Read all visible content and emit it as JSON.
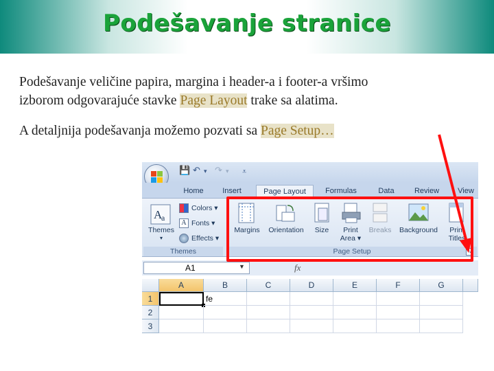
{
  "slide": {
    "title": "Podešavanje stranice",
    "para1_line1": "Podešavanje veličine  papira, margina i header-a i footer-a vršimo",
    "para1_line2_a": "izborom odgovarajuće stavke ",
    "para1_line2_hl": "Page Layout",
    "para1_line2_b": " trake sa alatima.",
    "para2_a": "A detaljnija podešavanja možemo pozvati sa ",
    "para2_hl": "Page Setup…",
    "accent_color": "#ff1010",
    "title_color": "#1aa33a"
  },
  "excel": {
    "tabs": [
      "Home",
      "Insert",
      "Page Layout",
      "Formulas",
      "Data",
      "Review",
      "View"
    ],
    "active_tab": "Page Layout",
    "themes_group": {
      "label": "Themes",
      "themes_button": "Themes",
      "colors": "Colors",
      "fonts": "Fonts",
      "effects": "Effects"
    },
    "page_setup_group": {
      "label": "Page Setup",
      "margins": "Margins",
      "orientation": "Orientation",
      "size": "Size",
      "print_area_1": "Print",
      "print_area_2": "Area",
      "breaks": "Breaks",
      "background": "Background",
      "print_titles_1": "Print",
      "print_titles_2": "Titles"
    },
    "name_box": "A1",
    "fx_label": "fx",
    "columns": [
      "A",
      "B",
      "C",
      "D",
      "E",
      "F",
      "G"
    ],
    "rows": [
      "1",
      "2",
      "3"
    ],
    "cell_b1_overflow": "fe"
  }
}
